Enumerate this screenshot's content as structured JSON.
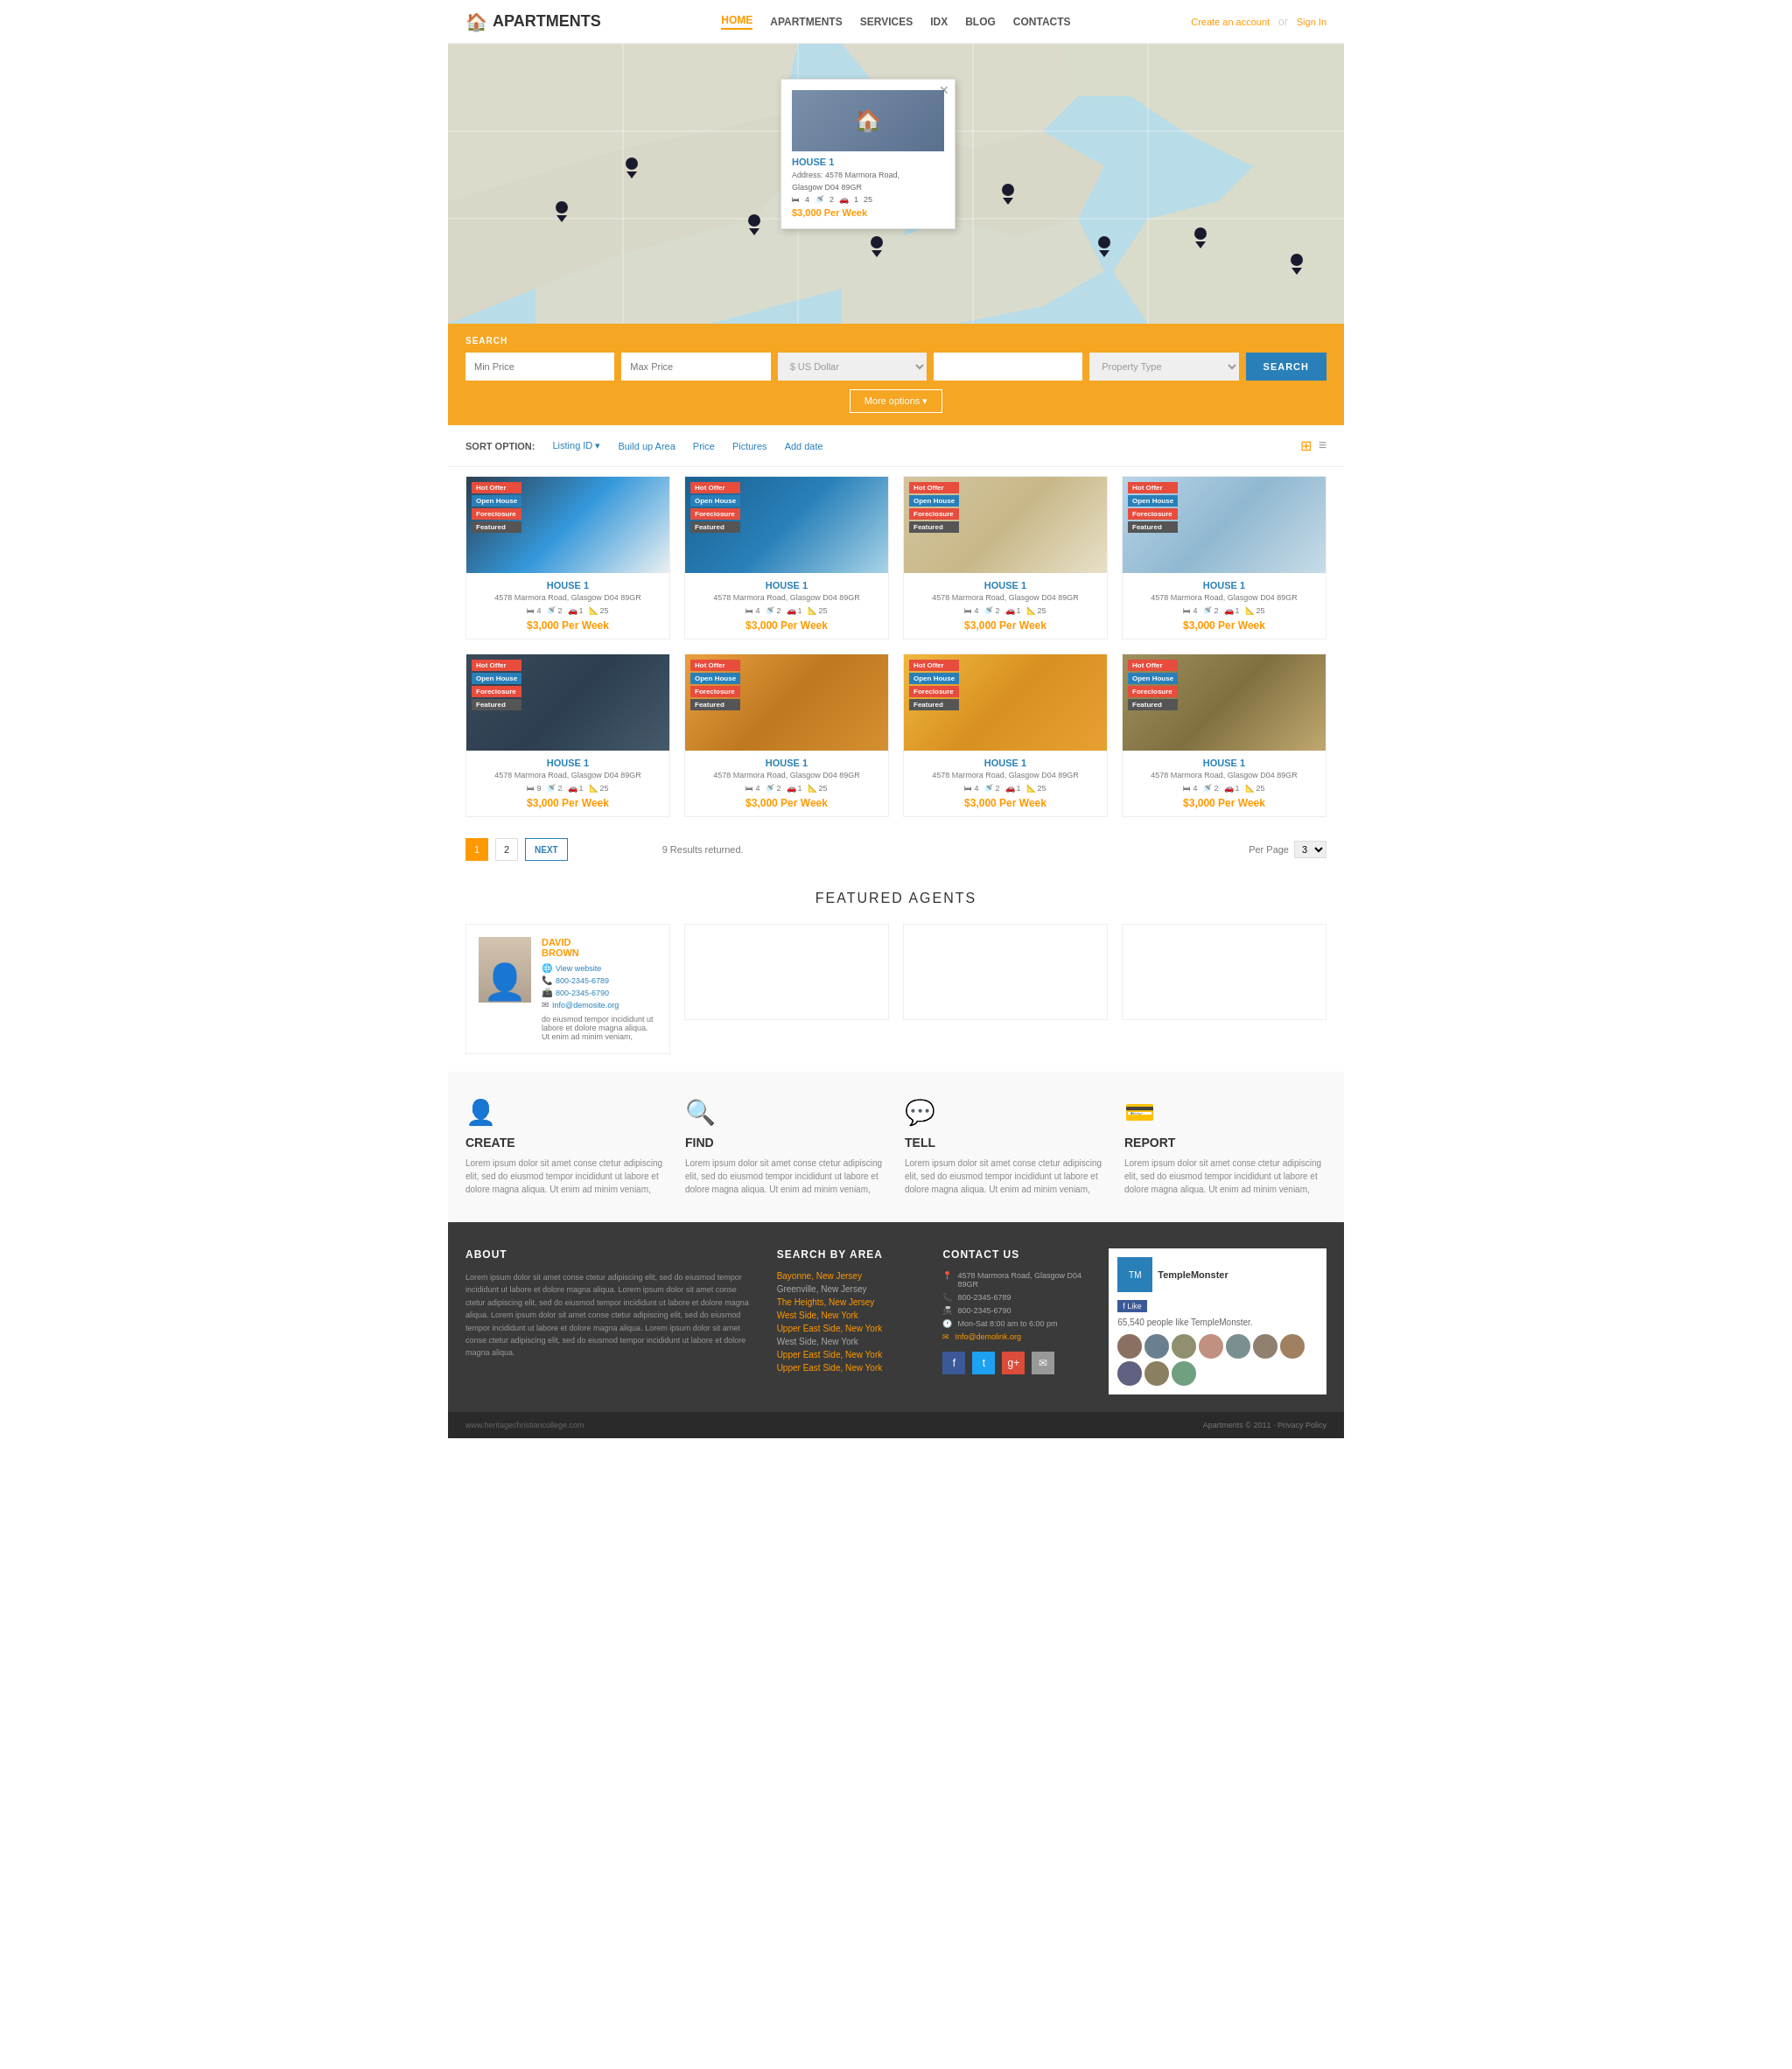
{
  "header": {
    "logo_text": "APARTMENTS",
    "logo_icon": "🏠",
    "nav": [
      {
        "label": "HOME",
        "active": true
      },
      {
        "label": "APARTMENTS",
        "active": false
      },
      {
        "label": "SERVICES",
        "active": false
      },
      {
        "label": "IDX",
        "active": false
      },
      {
        "label": "BLOG",
        "active": false
      },
      {
        "label": "CONTACTS",
        "active": false
      }
    ],
    "action_create": "Create an account",
    "action_divider": "or",
    "action_signin": "Sign In"
  },
  "popup": {
    "title": "HOUSE 1",
    "address": "Address: 4578 Marmora Road,",
    "city": "Glasgow D04 89GR",
    "price": "$3,000 Per Week",
    "bed": "4",
    "bath": "2",
    "garage": "1",
    "area": "25"
  },
  "search": {
    "label": "SEARCH",
    "min_price_placeholder": "Min Price",
    "max_price_placeholder": "Max Price",
    "currency_placeholder": "$ US Dollar",
    "location_placeholder": "",
    "property_type_placeholder": "Property Type",
    "button_label": "SEARCH",
    "more_options": "More options ▾"
  },
  "sort": {
    "label": "SORT OPTION:",
    "options": [
      {
        "label": "Listing ID ▾",
        "active": false
      },
      {
        "label": "Build up Area",
        "active": false
      },
      {
        "label": "Price",
        "active": false
      },
      {
        "label": "Pictures",
        "active": false
      },
      {
        "label": "Add date",
        "active": false
      }
    ]
  },
  "properties": [
    {
      "badges": [
        "Hot Offer",
        "Open House",
        "Foreclosure",
        "Featured"
      ],
      "title": "HOUSE 1",
      "address": "4578 Marmora Road, Glasgow D04 89GR",
      "beds": "4",
      "baths": "2",
      "garages": "1",
      "area": "25",
      "price": "$3,000 Per Week",
      "img_class": "img1"
    },
    {
      "badges": [
        "Hot Offer",
        "Open House",
        "Foreclosure",
        "Featured"
      ],
      "title": "HOUSE 1",
      "address": "4578 Marmora Road, Glasgow D04 89GR",
      "beds": "4",
      "baths": "2",
      "garages": "1",
      "area": "25",
      "price": "$3,000 Per Week",
      "img_class": "img2"
    },
    {
      "badges": [
        "Hot Offer",
        "Open House",
        "Foreclosure",
        "Featured"
      ],
      "title": "HOUSE 1",
      "address": "4578 Marmora Road, Glasgow D04 89GR",
      "beds": "4",
      "baths": "2",
      "garages": "1",
      "area": "25",
      "price": "$3,000 Per Week",
      "img_class": "img3"
    },
    {
      "badges": [
        "Hot Offer",
        "Open House",
        "Foreclosure",
        "Featured"
      ],
      "title": "HOUSE 1",
      "address": "4578 Marmora Road, Glasgow D04 89GR",
      "beds": "4",
      "baths": "2",
      "garages": "1",
      "area": "25",
      "price": "$3,000 Per Week",
      "img_class": "img4"
    },
    {
      "badges": [
        "Hot Offer",
        "Open House",
        "Foreclosure",
        "Featured"
      ],
      "title": "HOUSE 1",
      "address": "4578 Marmora Road, Glasgow D04 89GR",
      "beds": "9",
      "baths": "2",
      "garages": "1",
      "area": "25",
      "price": "$3,000 Per Week",
      "img_class": "img5"
    },
    {
      "badges": [
        "Hot Offer",
        "Open House",
        "Foreclosure",
        "Featured"
      ],
      "title": "HOUSE 1",
      "address": "4578 Marmora Road, Glasgow D04 89GR",
      "beds": "4",
      "baths": "2",
      "garages": "1",
      "area": "25",
      "price": "$3,000 Per Week",
      "img_class": "img6"
    },
    {
      "badges": [
        "Hot Offer",
        "Open House",
        "Foreclosure",
        "Featured"
      ],
      "title": "HOUSE 1",
      "address": "4578 Marmora Road, Glasgow D04 89GR",
      "beds": "4",
      "baths": "2",
      "garages": "1",
      "area": "25",
      "price": "$3,000 Per Week",
      "img_class": "img7"
    },
    {
      "badges": [
        "Hot Offer",
        "Open House",
        "Foreclosure",
        "Featured"
      ],
      "title": "HOUSE 1",
      "address": "4578 Marmora Road, Glasgow D04 89GR",
      "beds": "4",
      "baths": "2",
      "garages": "1",
      "area": "25",
      "price": "$3,000 Per Week",
      "img_class": "img8"
    }
  ],
  "pagination": {
    "pages": [
      "1",
      "2"
    ],
    "next_label": "NEXT",
    "results": "9 Results returned.",
    "per_page_label": "Per Page",
    "per_page_value": "3"
  },
  "agents": {
    "section_title": "FEATURED AGENTS",
    "agent": {
      "name": "DAVID\nBROWN",
      "website_label": "View website",
      "phone1": "800-2345-6789",
      "phone2": "800-2345-6790",
      "email": "Info@demosite.org",
      "description": "do eiusmod tempor incididunt ut labore et dolore magna aliqua. Ut enim ad minim veniam,"
    }
  },
  "features": [
    {
      "icon": "👤",
      "title": "CREATE",
      "text": "Lorem ipsum dolor sit amet conse ctetur adipiscing elit, sed do eiusmod tempor incididunt ut labore et dolore magna aliqua. Ut enim ad minim veniam,"
    },
    {
      "icon": "🔍",
      "title": "FIND",
      "text": "Lorem ipsum dolor sit amet conse ctetur adipiscing elit, sed do eiusmod tempor incididunt ut labore et dolore magna aliqua. Ut enim ad minim veniam,"
    },
    {
      "icon": "💬",
      "title": "TELL",
      "text": "Lorem ipsum dolor sit amet conse ctetur adipiscing elit, sed do eiusmod tempor incididunt ut labore et dolore magna aliqua. Ut enim ad minim veniam,"
    },
    {
      "icon": "💳",
      "title": "REPORT",
      "text": "Lorem ipsum dolor sit amet conse ctetur adipiscing elit, sed do eiusmod tempor incididunt ut labore et dolore magna aliqua. Ut enim ad minim veniam,"
    }
  ],
  "footer": {
    "about_title": "ABOUT",
    "about_text": "Lorem ipsum dolor sit amet conse ctetur adipiscing elit, sed do eiusmod tempor incididunt ut labore et dolore magna aliqua. Lorem ipsum dolor sit amet conse ctetur adipiscing elit, sed do eiusmod tempor incididunt ut labore et dolore magna aliqua. Lorem ipsum dolor sit amet conse ctetur adipiscing elit, sed do eiusmod tempor incididunt ut labore et dolore magna aliqua. Lorem ipsum dolor sit amet conse ctetur adipiscing elit, sed do eiusmod tempor incididunt ut labore et dolore magna aliqua.",
    "search_title": "SEARCH BY AREA",
    "search_links": [
      "Bayonne, New Jersey",
      "Greenville, New Jersey",
      "The Heights, New Jersey",
      "West Side, New York",
      "Upper East Side, New York",
      "West Side, New York",
      "Upper East Side, New York",
      "Upper East Side, New York"
    ],
    "contact_title": "CONTACT US",
    "contact_address": "4578 Marmora Road, Glasgow D04 89GR",
    "contact_phone1": "800-2345-6789",
    "contact_phone2": "800-2345-6790",
    "contact_hours": "Mon-Sat 8:00 am to 6:00 pm",
    "contact_email": "Info@demolink.org",
    "widget_name": "TempleMonster",
    "widget_like": "f Like",
    "widget_count": "65,540 people like TempleMonster.",
    "social": [
      "f",
      "t",
      "g+",
      "✉"
    ],
    "bottom_text": "Apartments © 2011 · Privacy Policy",
    "bottom_url": "www.heritagechristiancollege.com"
  }
}
